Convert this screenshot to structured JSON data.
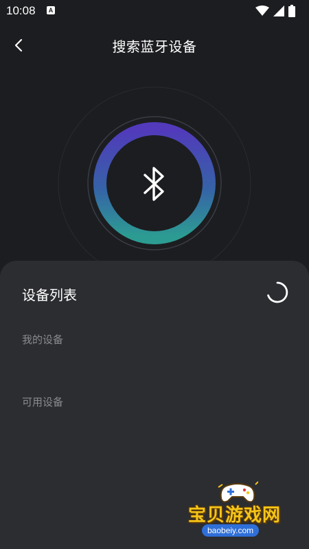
{
  "status_bar": {
    "time": "10:08",
    "notification_badge": "A",
    "icons": [
      "wifi-icon",
      "signal-icon",
      "battery-icon"
    ]
  },
  "header": {
    "title": "搜索蓝牙设备",
    "back_icon": "chevron-left-icon"
  },
  "radar": {
    "icon": "bluetooth-icon",
    "ring_colors": [
      "#5b3fd6",
      "#2fb3a6"
    ]
  },
  "device_sheet": {
    "title": "设备列表",
    "loading_icon": "loading-spinner-icon",
    "sections": {
      "my_devices": "我的设备",
      "available_devices": "可用设备"
    }
  },
  "watermark": {
    "brand": "宝贝游戏网",
    "url": "baobeiy.com"
  },
  "colors": {
    "background": "#1c1d20",
    "sheet": "#2c2d31",
    "muted_text": "#8a8b8f"
  }
}
